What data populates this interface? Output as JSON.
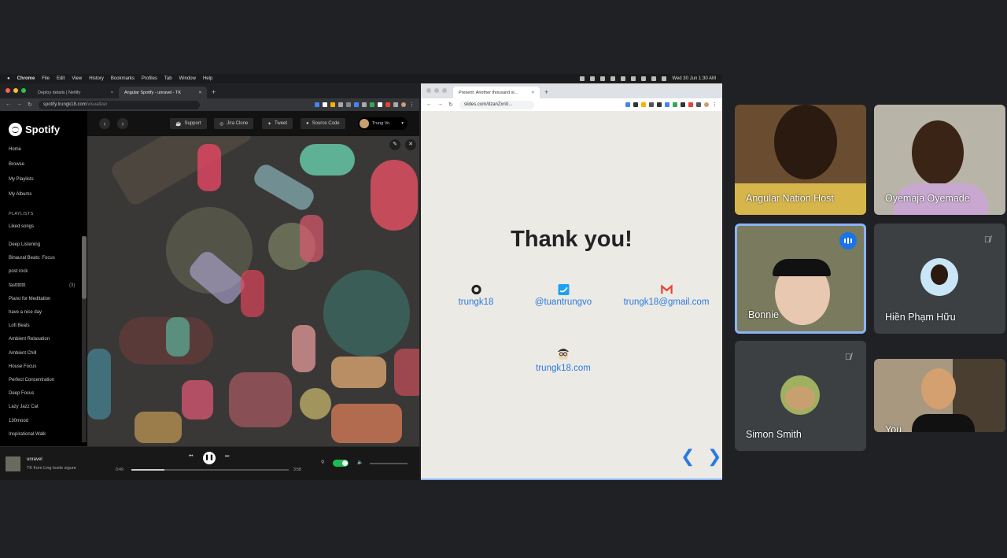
{
  "menubar": {
    "items": [
      "Chrome",
      "File",
      "Edit",
      "View",
      "History",
      "Bookmarks",
      "Profiles",
      "Tab",
      "Window",
      "Help"
    ],
    "clock": "Wed 30 Jun  1:30 AM"
  },
  "win1": {
    "tabs": [
      {
        "label": "Deploy details | Netlify"
      },
      {
        "label": "Angular Spotify - unravel - TK"
      }
    ],
    "url_host": "spotify.trungk18.com",
    "url_path": "/visualizer"
  },
  "spotify": {
    "logo": "Spotify",
    "nav": [
      "Home",
      "Browse",
      "My Playlists",
      "My Albums"
    ],
    "playlists_header": "PLAYLISTS",
    "liked": "Liked songs",
    "playlists": [
      {
        "name": "Deep Listening",
        "count": ""
      },
      {
        "name": "Binaural Beats: Focus",
        "count": ""
      },
      {
        "name": "post rock",
        "count": ""
      },
      {
        "name": "fastttttttt",
        "count": "(3)"
      },
      {
        "name": "Piano for Meditation",
        "count": ""
      },
      {
        "name": "have a nice day",
        "count": ""
      },
      {
        "name": "Lofi Beats",
        "count": ""
      },
      {
        "name": "Ambient Relaxation",
        "count": ""
      },
      {
        "name": "Ambient Chill",
        "count": ""
      },
      {
        "name": "House Focus",
        "count": ""
      },
      {
        "name": "Perfect Concentration",
        "count": ""
      },
      {
        "name": "Deep Focus",
        "count": ""
      },
      {
        "name": "Lazy Jazz Cat",
        "count": ""
      },
      {
        "name": "130mood",
        "count": ""
      },
      {
        "name": "Inspirational Walk",
        "count": ""
      }
    ],
    "top_buttons": {
      "support": "Support",
      "jira": "Jira Clone",
      "tweet": "Tweet",
      "source": "Source Code"
    },
    "user": "Trung Vo",
    "player": {
      "song": "unravel",
      "artist": "TK from Ling tosite sigure",
      "current": "0:49",
      "total": "3:58",
      "progress": 0.21
    }
  },
  "win2": {
    "tabs": [
      {
        "label": "Present: Another thousand sl..."
      }
    ],
    "url": "slides.com/dzanZxn0..."
  },
  "slide": {
    "title": "Thank you!",
    "github": "trungk18",
    "twitter": "@tuantrungvo",
    "email": "trungk18@gmail.com",
    "site": "trungk18.com",
    "prev": "❮",
    "next": "❯"
  },
  "meet": {
    "participants": [
      {
        "name": "Angular Nation Host"
      },
      {
        "name": "Oyemaja Oyemade"
      },
      {
        "name": "Bonnie"
      },
      {
        "name": "Hiền Phạm Hữu"
      },
      {
        "name": "Simon Smith"
      },
      {
        "name": "You"
      }
    ]
  },
  "colors": {
    "spotify_green": "#1db954",
    "link_blue": "#2a7ae2",
    "meet_blue": "#1a73e8"
  }
}
